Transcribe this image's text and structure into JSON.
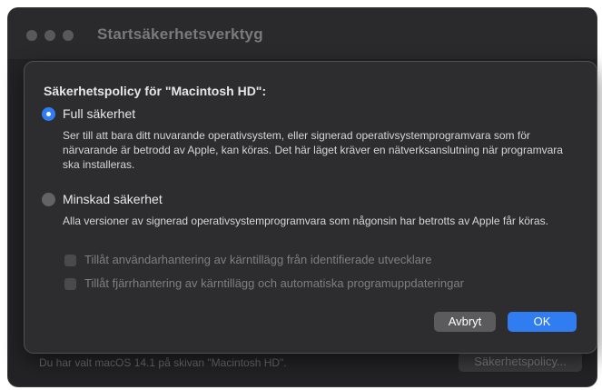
{
  "window": {
    "title": "Startsäkerhetsverktyg"
  },
  "background": {
    "status_text": "Du har valt macOS 14.1 på skivan \"Macintosh HD\".",
    "policy_button_label": "Säkerhetspolicy..."
  },
  "sheet": {
    "heading": "Säkerhetspolicy för \"Macintosh HD\":",
    "options": [
      {
        "label": "Full säkerhet",
        "selected": true,
        "description": "Ser till att bara ditt nuvarande operativsystem, eller signerad operativsystemprogramvara som för närvarande är betrodd av Apple, kan köras. Det här läget kräver en nätverksanslutning när programvara ska installeras."
      },
      {
        "label": "Minskad säkerhet",
        "selected": false,
        "description": "Alla versioner av signerad operativsystemprogramvara som någonsin har betrotts av Apple får köras."
      }
    ],
    "checkboxes": [
      {
        "label": "Tillåt användarhantering av kärntillägg från identifierade utvecklare",
        "checked": false,
        "enabled": false
      },
      {
        "label": "Tillåt fjärrhantering av kärntillägg och automatiska programuppdateringar",
        "checked": false,
        "enabled": false
      }
    ],
    "buttons": {
      "cancel": "Avbryt",
      "ok": "OK"
    }
  },
  "colors": {
    "accent": "#2f7df0",
    "window_bg": "#232325",
    "sheet_bg": "#2d2d2f"
  }
}
